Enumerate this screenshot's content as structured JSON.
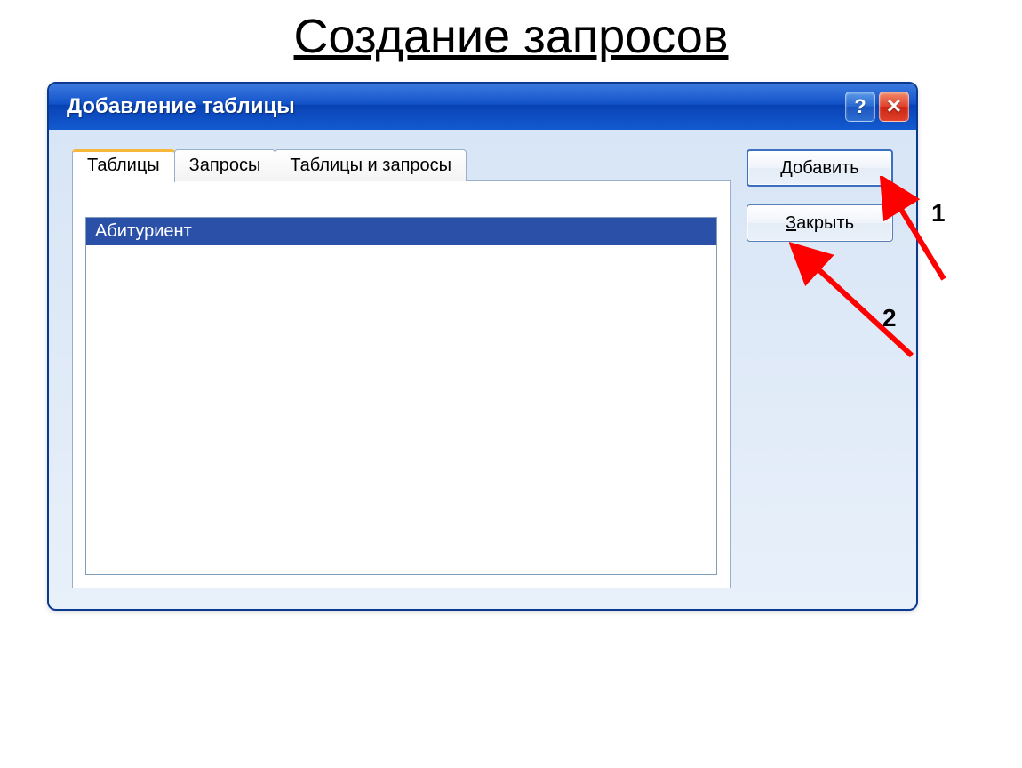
{
  "page": {
    "title": "Создание запросов"
  },
  "dialog": {
    "title": "Добавление таблицы",
    "tabs": [
      {
        "label": "Таблицы",
        "active": true
      },
      {
        "label": "Запросы",
        "active": false
      },
      {
        "label": "Таблицы и запросы",
        "active": false
      }
    ],
    "list_items": [
      {
        "label": "Абитуриент",
        "selected": true
      }
    ],
    "buttons": {
      "add": {
        "mnemonic": "Д",
        "rest": "обавить"
      },
      "close": {
        "mnemonic": "З",
        "rest": "акрыть"
      }
    },
    "titlebar_icons": {
      "help": "?",
      "close": "✕"
    }
  },
  "annotations": {
    "label1": "1",
    "label2": "2"
  }
}
